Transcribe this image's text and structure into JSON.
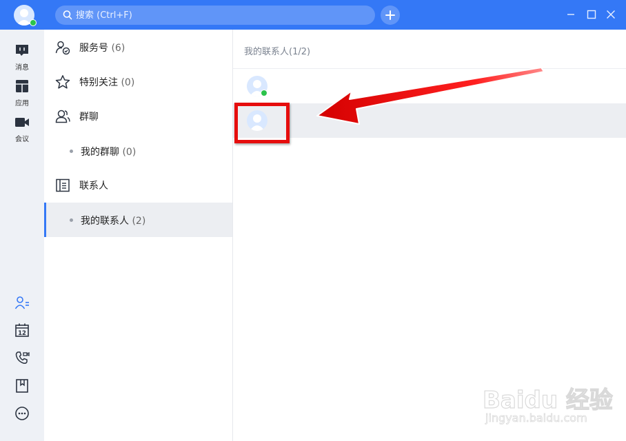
{
  "search": {
    "placeholder": "搜索 (Ctrl+F)"
  },
  "sidebar": {
    "items": [
      {
        "label": "消息",
        "icon": "message-icon"
      },
      {
        "label": "应用",
        "icon": "apps-icon"
      },
      {
        "label": "会议",
        "icon": "meeting-icon"
      }
    ],
    "bottom_icons": [
      "contacts-icon",
      "calendar-icon",
      "phone-video-icon",
      "bookmark-icon",
      "more-icon"
    ],
    "calendar_day": "12"
  },
  "groups": {
    "service": {
      "label": "服务号",
      "count": "(6)"
    },
    "special": {
      "label": "特别关注",
      "count": "(0)"
    },
    "group_chat": {
      "label": "群聊"
    },
    "my_groups": {
      "label": "我的群聊",
      "count": "(0)"
    },
    "contacts": {
      "label": "联系人"
    },
    "my_contacts": {
      "label": "我的联系人",
      "count": "(2)"
    }
  },
  "contacts_panel": {
    "header": "我的联系人(1/2)",
    "rows": [
      {
        "online": true,
        "selected": false
      },
      {
        "online": false,
        "selected": true
      }
    ]
  },
  "watermark": {
    "logo": "Baidu 经验",
    "sub": "jingyan.baidu.com"
  },
  "colors": {
    "accent": "#3478f6",
    "online": "#2bc34b",
    "annotation": "#e60d0d"
  }
}
